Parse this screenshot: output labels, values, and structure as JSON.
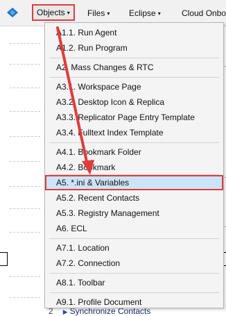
{
  "menubar": {
    "items": [
      {
        "label": "Objects",
        "caret": "▾"
      },
      {
        "label": "Files",
        "caret": "▾"
      },
      {
        "label": "Eclipse",
        "caret": "▾"
      },
      {
        "label": "Cloud Onbo",
        "caret": ""
      }
    ],
    "active_index": 0
  },
  "dropdown": {
    "items": [
      "A1.1. Run Agent",
      "A1.2. Run Program",
      "A2. Mass Changes & RTC",
      "A3.1. Workspace Page",
      "A3.2. Desktop Icon & Replica",
      "A3.3. Replicator Page Entry Template",
      "A3.4. Fulltext Index Template",
      "A4.1. Bookmark Folder",
      "A4.2. Bookmark",
      "A5. *.ini & Variables",
      "A5.2. Recent Contacts",
      "A5.3. Registry Management",
      "A6. ECL",
      "A7.1. Location",
      "A7.2. Connection",
      "A8.1. Toolbar",
      "A9.1. Profile Document"
    ],
    "selected_index": 9
  },
  "background": {
    "bottom_item": "Synchronize Contacts",
    "bottom_num": "2"
  },
  "colors": {
    "highlight_border": "#e23b3b",
    "selection_fill": "#cce4f7",
    "arrow": "#e23b3b",
    "logo": "#1e73c8"
  },
  "icons": [
    "app-logo-icon",
    "arrow-annotation",
    "expand-triangle-icon"
  ]
}
